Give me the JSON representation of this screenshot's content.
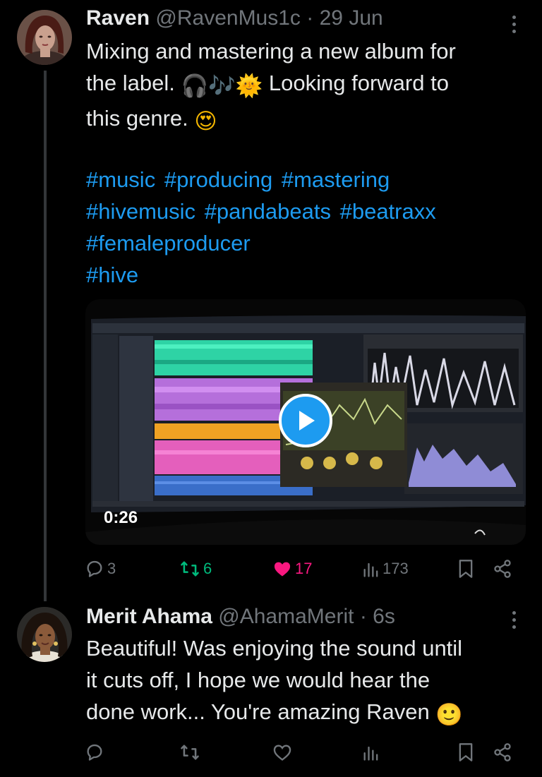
{
  "tweet": {
    "author_name": "Raven",
    "author_handle": "@RavenMus1c",
    "separator": "·",
    "date": "29 Jun",
    "text_line1": "Mixing and mastering a new album for",
    "text_line2a": "the label.",
    "text_line2b": "Looking forward to",
    "text_line3": "this genre.",
    "hashtags": [
      "#music",
      "#producing",
      "#mastering",
      "#hivemusic",
      "#pandabeats",
      "#beatraxx",
      "#femaleproducer",
      "#hive"
    ],
    "video_duration": "0:26",
    "replies": "3",
    "reposts": "6",
    "likes": "17",
    "views": "173"
  },
  "reply": {
    "author_name": "Merit Ahama",
    "author_handle": "@AhamaMerit",
    "separator": "·",
    "date": "6s",
    "text_line1": "Beautiful! Was enjoying the sound until",
    "text_line2": "it cuts off, I hope we would hear the",
    "text_line3": "done work... You're amazing Raven"
  },
  "icons": {
    "reply": "reply-icon",
    "repost": "repost-icon",
    "like": "heart-icon",
    "views": "views-icon",
    "bookmark": "bookmark-icon",
    "share": "share-icon",
    "more": "more-icon",
    "play": "play-icon"
  },
  "colors": {
    "background": "#000000",
    "text": "#e7e9ea",
    "muted": "#71767b",
    "link": "#1d9bf0",
    "like": "#f91880",
    "repost": "#00ba7c"
  }
}
